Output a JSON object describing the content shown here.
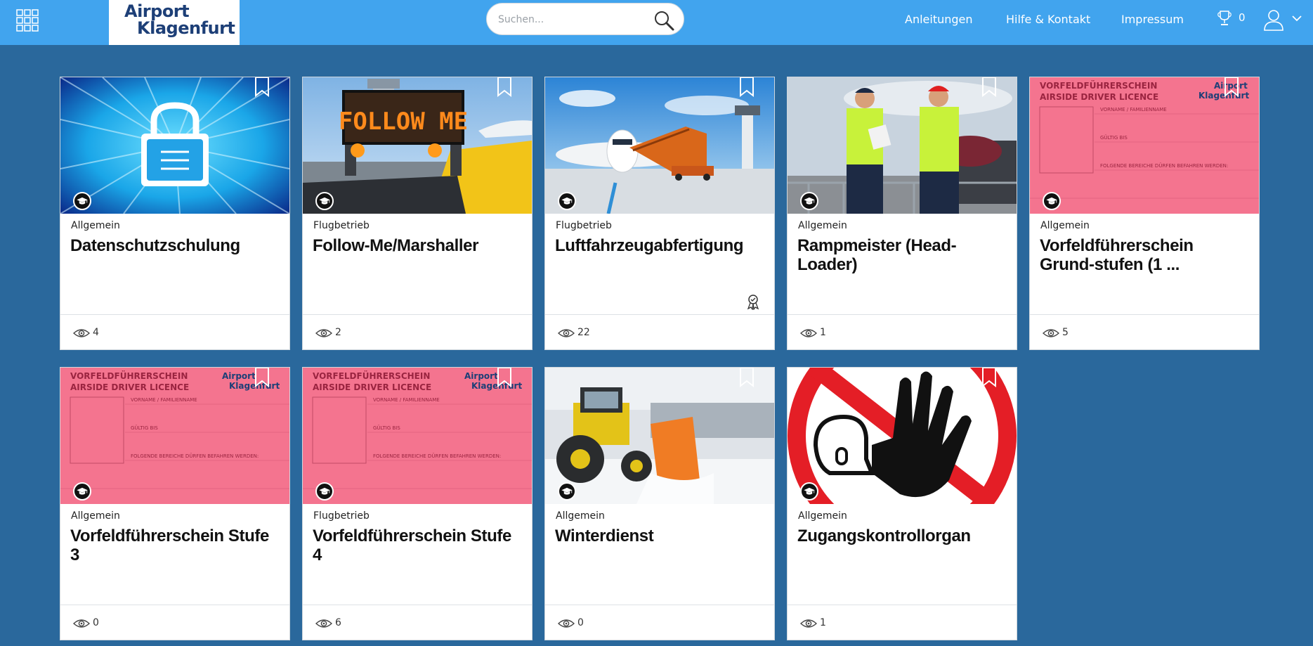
{
  "header": {
    "logo_line1": "Airport",
    "logo_line2": "Klagenfurt",
    "search_placeholder": "Suchen...",
    "nav": [
      "Anleitungen",
      "Hilfe & Kontakt",
      "Impressum"
    ],
    "trophy_count": "0"
  },
  "colors": {
    "topbar": "#41a4ee",
    "background": "#2a689c",
    "logo_text": "#1d3f77",
    "licence_pink": "#f4748f"
  },
  "icons": {
    "apps": "grid-icon",
    "search": "search-icon",
    "trophy": "trophy-icon",
    "user": "user-icon",
    "bookmark": "bookmark-icon",
    "course": "graduation-cap-icon",
    "views": "eye-icon",
    "certificate": "award-icon"
  },
  "licence_card_text": {
    "title1": "VORFELDFÜHRERSCHEIN",
    "title2": "AIRSIDE DRIVER LICENCE",
    "field1": "VORNAME / FAMILIENNAME",
    "field2": "GÜLTIG BIS",
    "field3": "FOLGENDE BEREICHE DÜRFEN BEFAHREN WERDEN:",
    "logo1": "Airport",
    "logo2": "Klagenfurt"
  },
  "courses": [
    {
      "category": "Allgemein",
      "title": "Datenschutzschulung",
      "views": "4"
    },
    {
      "category": "Flugbetrieb",
      "title": "Follow-Me/Marshaller",
      "views": "2",
      "sign": "FOLLOW ME"
    },
    {
      "category": "Flugbetrieb",
      "title": "Luftfahrzeugabfertigung",
      "views": "22"
    },
    {
      "category": "Allgemein",
      "title": "Rampmeister (Head-Loader)",
      "views": "1"
    },
    {
      "category": "Allgemein",
      "title": "Vorfeldführerschein Grund-stufen (1 ...",
      "views": "5"
    },
    {
      "category": "Allgemein",
      "title": "Vorfeldführerschein Stufe 3",
      "views": "0"
    },
    {
      "category": "Flugbetrieb",
      "title": "Vorfeldführerschein Stufe 4",
      "views": "6"
    },
    {
      "category": "Allgemein",
      "title": "Winterdienst",
      "views": "0"
    },
    {
      "category": "Allgemein",
      "title": "Zugangskontrollorgan",
      "views": "1"
    }
  ]
}
